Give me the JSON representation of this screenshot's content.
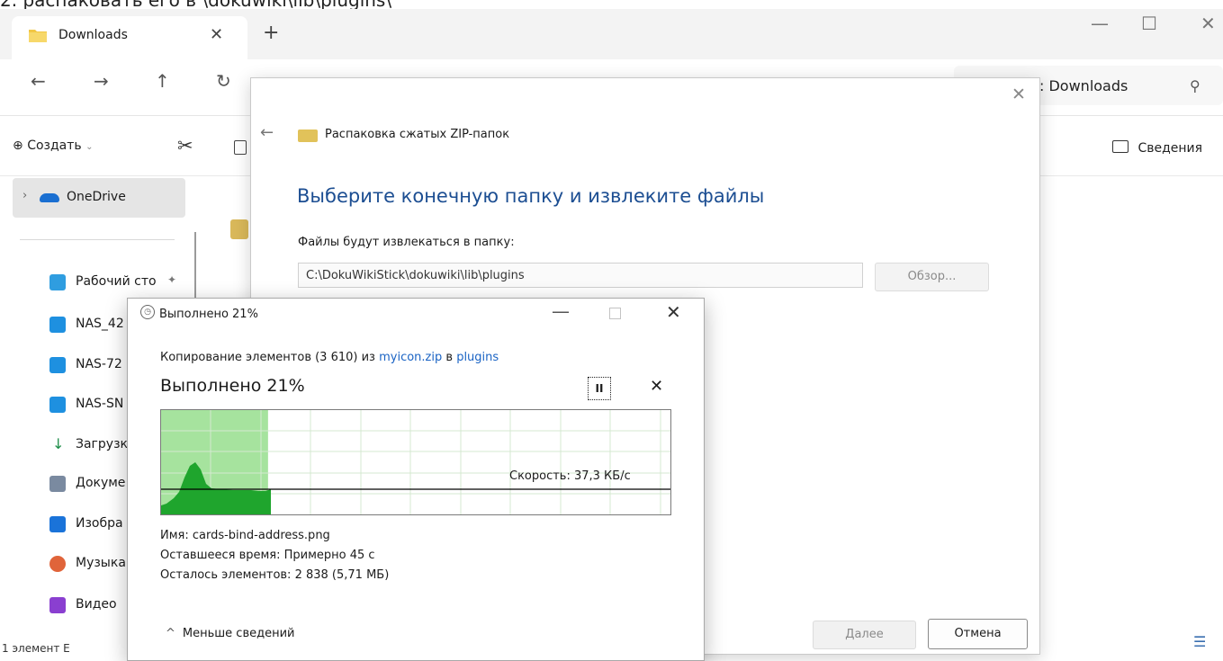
{
  "caption": "2. распаковать его в \\dokuwiki\\lib\\plugins\\",
  "explorer": {
    "tab_title": "Downloads",
    "tab_close": "✕",
    "new_tab": "+",
    "window_buttons": [
      "—",
      "☐",
      "✕"
    ],
    "nav_icons": [
      "arrow-left-icon",
      "arrow-right-icon",
      "arrow-up-icon",
      "refresh-icon"
    ],
    "search_text": ": Downloads",
    "toolbar": {
      "create_label": "Создать",
      "details_label": "Сведения"
    },
    "sidebar": {
      "onedrive": "OneDrive",
      "items": [
        {
          "label": "Рабочий сто",
          "icon": "desktop-icon",
          "color": "#2f9de0"
        },
        {
          "label": "NAS_42",
          "icon": "network-drive-icon",
          "color": "#1e90e0"
        },
        {
          "label": "NAS-72",
          "icon": "network-drive-icon",
          "color": "#1e90e0"
        },
        {
          "label": "NAS-SN",
          "icon": "network-drive-icon",
          "color": "#1e90e0"
        },
        {
          "label": "Загрузк",
          "icon": "download-icon",
          "color": "#1f8f4a"
        },
        {
          "label": "Докуме",
          "icon": "document-icon",
          "color": "#7a8aa0"
        },
        {
          "label": "Изобра",
          "icon": "image-icon",
          "color": "#1a73d9"
        },
        {
          "label": "Музыка",
          "icon": "music-icon",
          "color": "#e0643a"
        },
        {
          "label": "Видео",
          "icon": "video-icon",
          "color": "#8a3fd0"
        }
      ]
    },
    "status_left": "1 элемент   Е"
  },
  "wizard": {
    "title": "Распаковка сжатых ZIP-папок",
    "heading": "Выберите конечную папку и извлеките файлы",
    "extract_label": "Файлы будут извлекаться в папку:",
    "path": "C:\\DokuWikiStick\\dokuwiki\\lib\\plugins",
    "browse_label": "Обзор...",
    "next_label": "Далее",
    "cancel_label": "Отмена"
  },
  "progress": {
    "title": "Выполнено 21%",
    "copy_prefix": "Копирование элементов (3 610) из ",
    "source": "myicon.zip",
    "copy_mid": " в ",
    "destination": "plugins",
    "percent_text": "Выполнено 21%",
    "percent_value": 21,
    "pause_label": "II",
    "stop_label": "✕",
    "speed_label": "Скорость: 37,3 КБ/с",
    "file_name": "Имя:  cards-bind-address.png",
    "time_left": "Оставшееся время:  Примерно 45 с",
    "items_left": "Осталось элементов:  2 838 (5,71 МБ)",
    "less_details": "Меньше сведений",
    "chevron": "^"
  }
}
